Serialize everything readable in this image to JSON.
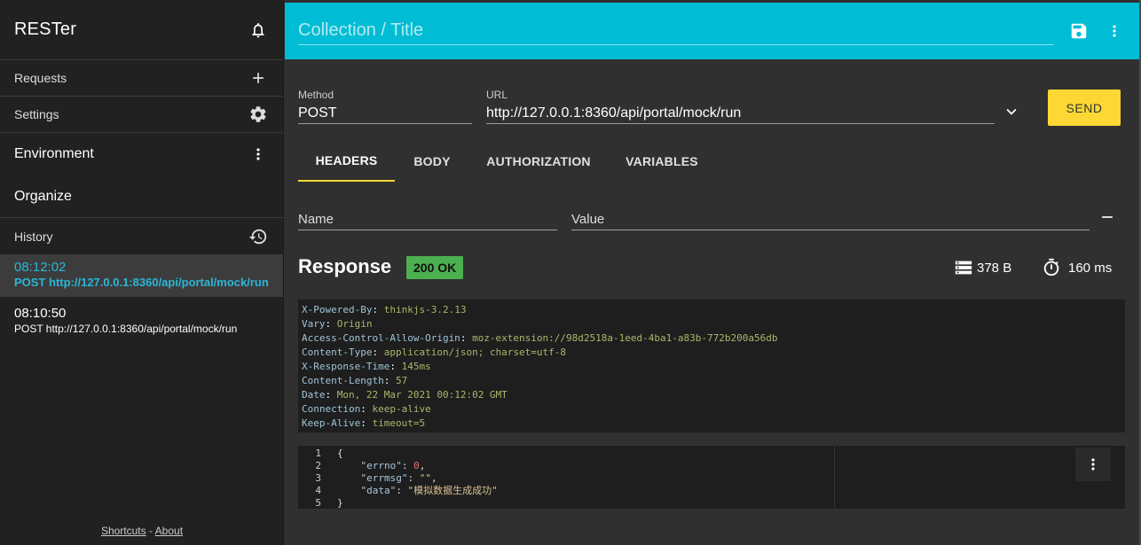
{
  "sidebar": {
    "app_title": "RESTer",
    "requests_label": "Requests",
    "settings_label": "Settings",
    "environment_label": "Environment",
    "organize_label": "Organize",
    "history_label": "History",
    "history": [
      {
        "time": "08:12:02",
        "url": "POST http://127.0.0.1:8360/api/portal/mock/run",
        "active": true
      },
      {
        "time": "08:10:50",
        "url": "POST http://127.0.0.1:8360/api/portal/mock/run",
        "active": false
      }
    ],
    "footer": {
      "shortcuts": "Shortcuts",
      "separator": " - ",
      "about": "About"
    }
  },
  "topbar": {
    "title_placeholder": "Collection / Title",
    "accent": "#00bcd4"
  },
  "request": {
    "method_label": "Method",
    "method_value": "POST",
    "url_label": "URL",
    "url_value": "http://127.0.0.1:8360/api/portal/mock/run",
    "send_label": "SEND"
  },
  "tabs": [
    {
      "label": "HEADERS",
      "active": true
    },
    {
      "label": "BODY",
      "active": false
    },
    {
      "label": "AUTHORIZATION",
      "active": false
    },
    {
      "label": "VARIABLES",
      "active": false
    }
  ],
  "headers_form": {
    "name_placeholder": "Name",
    "value_placeholder": "Value"
  },
  "response": {
    "title": "Response",
    "status": "200 OK",
    "size": "378 B",
    "time": "160 ms",
    "headers": [
      {
        "name": "X-Powered-By",
        "value": "thinkjs-3.2.13"
      },
      {
        "name": "Vary",
        "value": "Origin"
      },
      {
        "name": "Access-Control-Allow-Origin",
        "value": "moz-extension://98d2518a-1eed-4ba1-a83b-772b200a56db"
      },
      {
        "name": "Content-Type",
        "value": "application/json; charset=utf-8"
      },
      {
        "name": "X-Response-Time",
        "value": "145ms"
      },
      {
        "name": "Content-Length",
        "value": "57"
      },
      {
        "name": "Date",
        "value": "Mon, 22 Mar 2021 00:12:02 GMT"
      },
      {
        "name": "Connection",
        "value": "keep-alive"
      },
      {
        "name": "Keep-Alive",
        "value": "timeout=5"
      }
    ],
    "body_lines": [
      "1",
      "2",
      "3",
      "4",
      "5"
    ],
    "body": {
      "open": "{",
      "errno_key": "\"errno\"",
      "errno_val": "0",
      "errmsg_key": "\"errmsg\"",
      "errmsg_val": "\"\"",
      "data_key": "\"data\"",
      "data_val": "\"模拟数据生成成功\"",
      "close": "}"
    }
  }
}
